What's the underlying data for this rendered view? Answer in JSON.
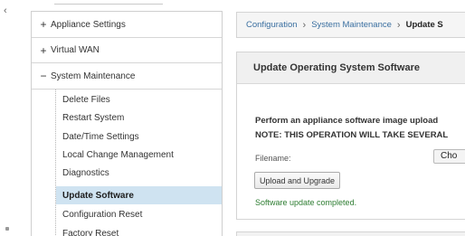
{
  "sidebar": {
    "groups": [
      {
        "sign": "+",
        "label": "Appliance Settings"
      },
      {
        "sign": "+",
        "label": "Virtual WAN"
      },
      {
        "sign": "−",
        "label": "System Maintenance"
      }
    ],
    "items": [
      {
        "label": "Delete Files"
      },
      {
        "label": "Restart System"
      },
      {
        "label": "Date/Time Settings"
      },
      {
        "label": "Local Change Management"
      },
      {
        "label": "Diagnostics"
      },
      {
        "label": "Update Software",
        "active": true
      },
      {
        "label": "Configuration Reset"
      },
      {
        "label": "Factory Reset"
      }
    ]
  },
  "breadcrumb": {
    "items": [
      "Configuration",
      "System Maintenance",
      "Update S"
    ],
    "separator": "›"
  },
  "panel": {
    "title": "Update Operating System Software",
    "instruction_line1": "Perform an appliance software image upload",
    "instruction_line2": "NOTE: THIS OPERATION WILL TAKE SEVERAL",
    "filename_label": "Filename:",
    "choose_button_label": "Cho",
    "upload_button_label": "Upload and Upgrade",
    "status_text": "Software update completed."
  },
  "colors": {
    "active_item_bg": "#cfe3f1",
    "link": "#3a6fa0",
    "success": "#2e7d32"
  },
  "icons": {
    "top_left": "chevron-left-icon"
  }
}
